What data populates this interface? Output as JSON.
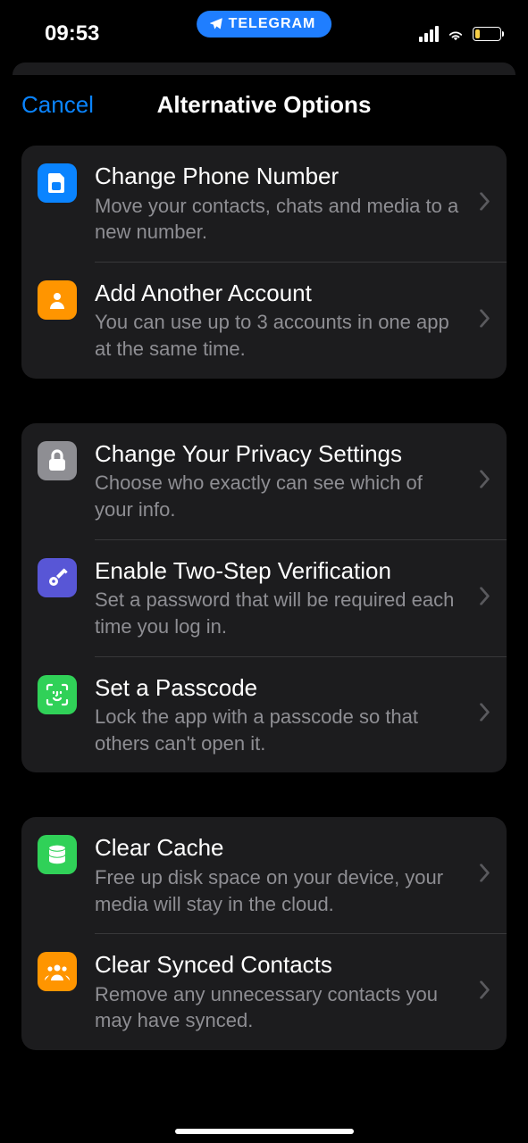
{
  "status": {
    "time": "09:53",
    "appPill": "TELEGRAM"
  },
  "nav": {
    "cancel": "Cancel",
    "title": "Alternative Options"
  },
  "sections": [
    {
      "rows": [
        {
          "title": "Change Phone Number",
          "subtitle": "Move your contacts, chats and media to a new number."
        },
        {
          "title": "Add Another Account",
          "subtitle": "You can use up to 3 accounts in one app at the same time."
        }
      ]
    },
    {
      "rows": [
        {
          "title": "Change Your Privacy Settings",
          "subtitle": "Choose who exactly can see which of your info."
        },
        {
          "title": "Enable Two-Step Verification",
          "subtitle": "Set a password that will be required each time you log in."
        },
        {
          "title": "Set a Passcode",
          "subtitle": "Lock the app with a passcode so that others can't open it."
        }
      ]
    },
    {
      "rows": [
        {
          "title": "Clear Cache",
          "subtitle": "Free up disk space on your device, your media will stay in the cloud."
        },
        {
          "title": "Clear Synced Contacts",
          "subtitle": "Remove any unnecessary contacts you may have synced."
        }
      ]
    }
  ]
}
